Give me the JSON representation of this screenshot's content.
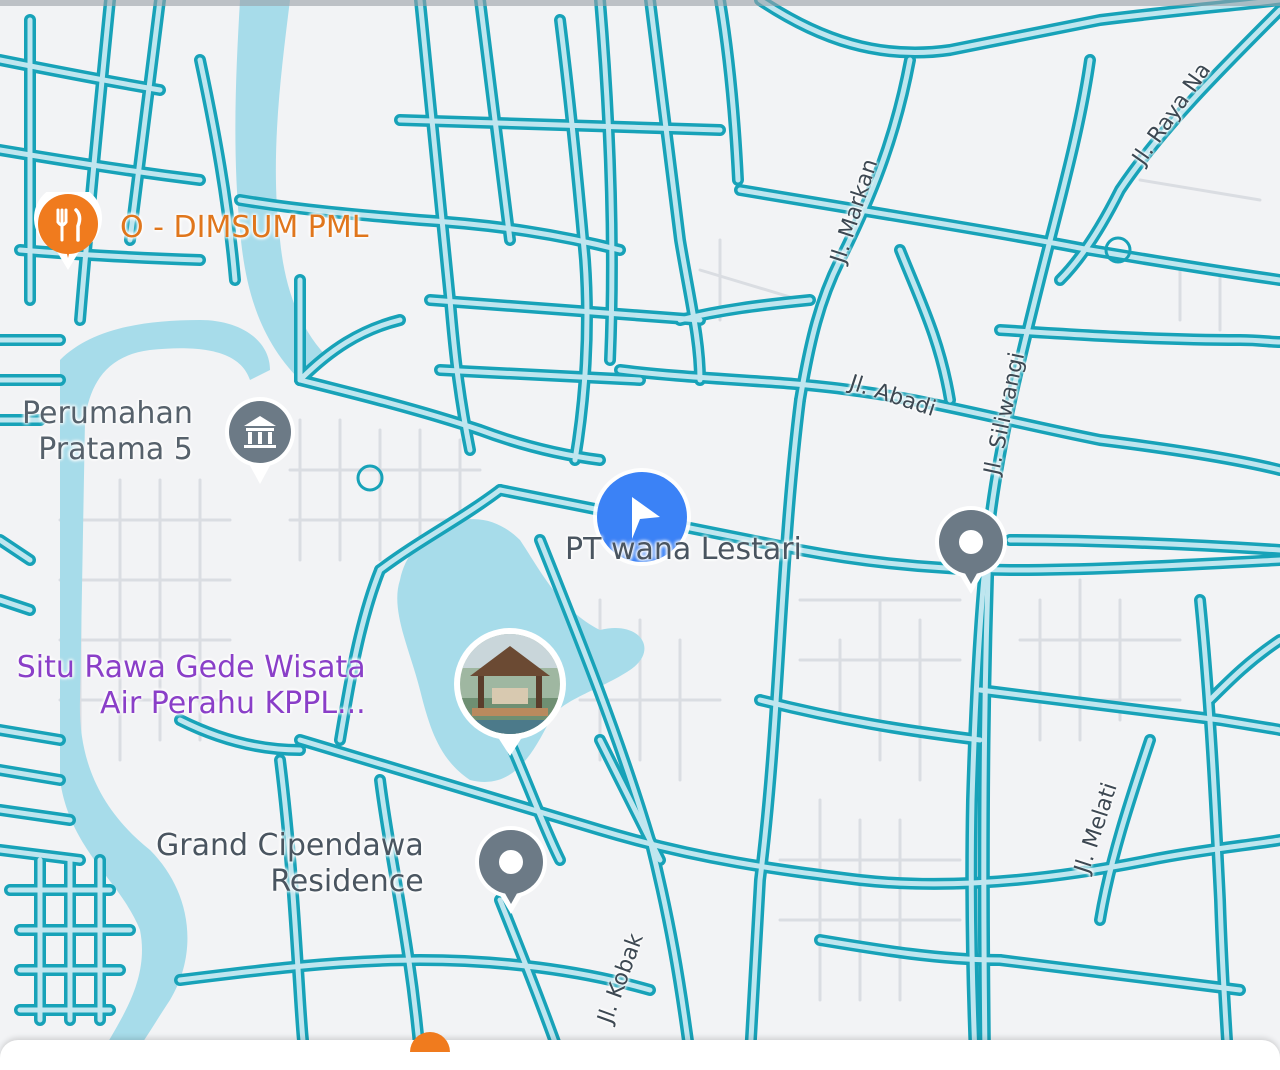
{
  "map": {
    "streets": [
      {
        "id": "markan",
        "label": "Jl. Markan"
      },
      {
        "id": "abadi",
        "label": "Jl. Abadi"
      },
      {
        "id": "siliwangi",
        "label": "Jl. Siliwangi"
      },
      {
        "id": "raya",
        "label": "Jl. Raya Na"
      },
      {
        "id": "melati",
        "label": "Jl. Melati"
      },
      {
        "id": "kobak",
        "label": "Jl. Kobak"
      }
    ],
    "pois": {
      "dimsum": {
        "label": "O - DIMSUM PML",
        "icon": "restaurant-icon",
        "color": "#f07b1e"
      },
      "perumahan": {
        "line1": "Perumahan",
        "line2": "Pratama 5",
        "icon": "building-icon",
        "color": "#6c7a86"
      },
      "lestari": {
        "label": "PT. ...wana Lestari",
        "label_visible": "PT    wana Lestari",
        "icon": "location-pin-icon"
      },
      "situ": {
        "line1": "Situ Rawa Gede Wisata",
        "line2": "Air Perahu KPPL...",
        "icon": "photo-thumbnail-icon",
        "color": "#8a3fc8"
      },
      "grand": {
        "line1": "Grand Cipendawa",
        "line2": "Residence",
        "icon": "location-pin-icon"
      }
    },
    "navigation_arrow": {
      "icon": "navigation-arrow-icon",
      "color": "#3b82f6"
    },
    "colors": {
      "road": "#17a2b8",
      "road_fill": "#bfe6ef",
      "water": "#a7dcea",
      "background": "#f2f3f5"
    }
  }
}
